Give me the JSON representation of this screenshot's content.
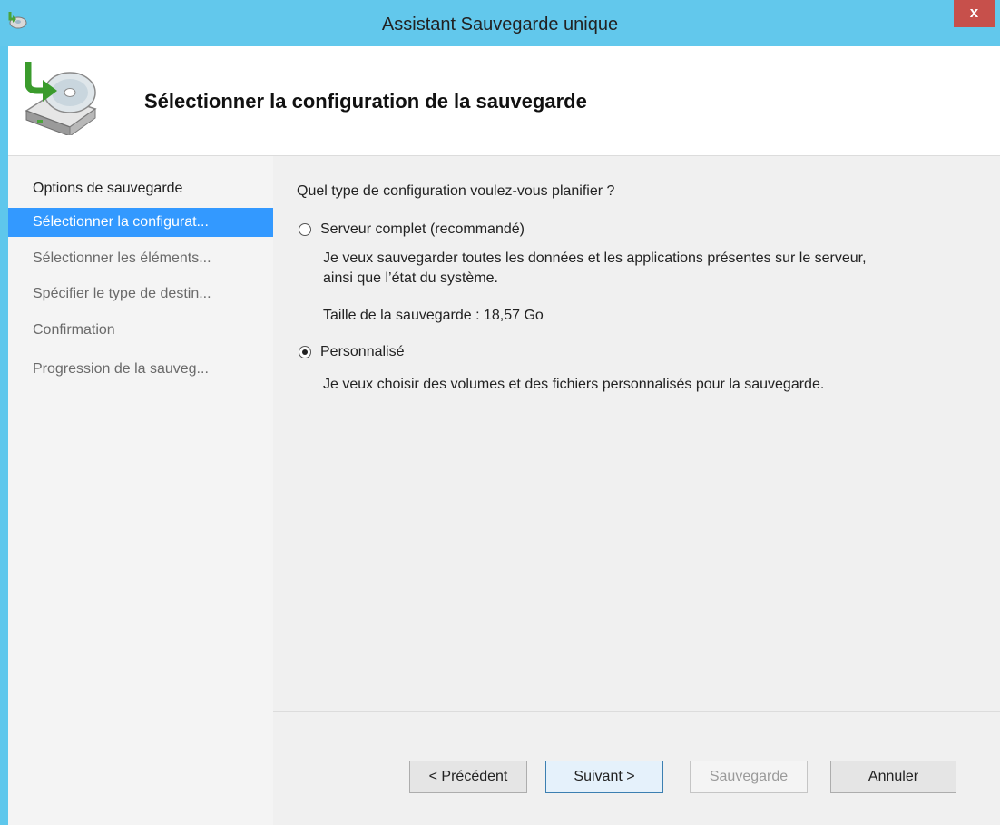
{
  "window": {
    "title": "Assistant Sauvegarde unique",
    "close_label": "x"
  },
  "header": {
    "title": "Sélectionner la configuration de la sauvegarde"
  },
  "nav": {
    "items": [
      {
        "label": "Options de sauvegarde",
        "state": "done"
      },
      {
        "label": "Sélectionner la configurat...",
        "state": "active"
      },
      {
        "label": "Sélectionner les éléments...",
        "state": "pending"
      },
      {
        "label": "Spécifier le type de destin...",
        "state": "pending"
      },
      {
        "label": "Confirmation",
        "state": "pending"
      },
      {
        "label": "Progression de la sauveg...",
        "state": "pending"
      }
    ]
  },
  "main": {
    "question": "Quel type de configuration voulez-vous planifier ?",
    "options": [
      {
        "label": "Serveur complet (recommandé)",
        "selected": false,
        "description_line1": "Je veux sauvegarder toutes les données et les applications présentes sur le serveur,",
        "description_line2": "ainsi que l’état du système.",
        "size_text": "Taille de la sauvegarde : 18,57 Go"
      },
      {
        "label": "Personnalisé",
        "selected": true,
        "description": "Je veux choisir des volumes et des fichiers personnalisés pour la sauvegarde."
      }
    ]
  },
  "buttons": {
    "previous": "< Précédent",
    "next": "Suivant >",
    "backup": "Sauvegarde",
    "cancel": "Annuler"
  },
  "colors": {
    "titlebar": "#62c8ec",
    "nav_active": "#3399ff",
    "close_button": "#c7504b"
  },
  "icons": {
    "app": "backup-app-icon",
    "header": "disk-backup-arrow-icon"
  }
}
